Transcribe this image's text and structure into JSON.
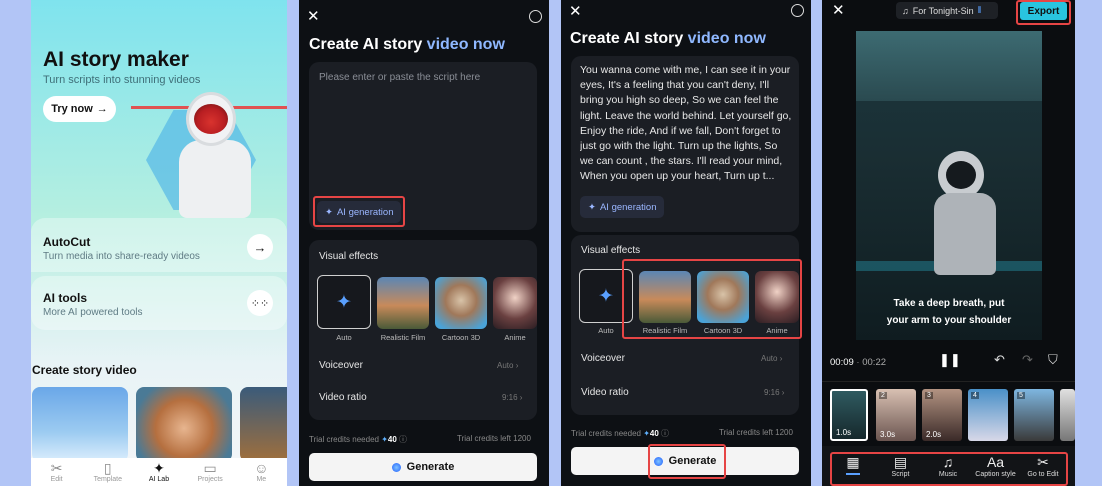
{
  "colors": {
    "accent_blue": "#5aa0ff",
    "highlight_red": "#e64545",
    "export_cyan": "#29c4df",
    "bg_dark": "#0d1014"
  },
  "screen1": {
    "hero_title": "AI story maker",
    "hero_subtitle": "Turn scripts into stunning videos",
    "try_button": "Try now",
    "try_icon": "arrow-right-icon",
    "autocut_title": "AutoCut",
    "autocut_subtitle": "Turn media into share-ready videos",
    "aitools_title": "AI tools",
    "aitools_subtitle": "More AI powered tools",
    "section_title": "Create story video",
    "tabs": [
      {
        "label": "Edit",
        "icon": "scissors-icon"
      },
      {
        "label": "Template",
        "icon": "template-icon"
      },
      {
        "label": "AI Lab",
        "icon": "sparkle-icon"
      },
      {
        "label": "Projects",
        "icon": "folder-icon"
      },
      {
        "label": "Me",
        "icon": "person-icon"
      }
    ]
  },
  "screen2": {
    "title_main": "Create AI story ",
    "title_accent": "video now",
    "placeholder": "Please enter or paste the script here",
    "ai_generation": "AI generation",
    "visual_effects": "Visual effects",
    "options": [
      "Auto",
      "Realistic Film",
      "Cartoon 3D",
      "Anime"
    ],
    "voiceover": "Voiceover",
    "voiceover_value": "Auto",
    "video_ratio": "Video ratio",
    "video_ratio_value": "9:16",
    "credits_needed": "Trial credits needed",
    "credits_amount": "40",
    "credits_left": "Trial credits left 1200",
    "generate": "Generate"
  },
  "screen3": {
    "title_main": "Create AI story ",
    "title_accent": "video now",
    "script": "You wanna come with me, I can see it in your eyes, It's a feeling that you can't deny, I'll bring you high so deep, So we can feel the light. Leave the world behind. Let yourself go, Enjoy the ride, And if we fall, Don't forget to just go with the light. Turn up the lights, So we can count , the stars. I'll read your mind, When you open up your heart, Turn up t...",
    "ai_generation": "AI generation",
    "visual_effects": "Visual effects",
    "options": [
      "Auto",
      "Realistic Film",
      "Cartoon 3D",
      "Anime"
    ],
    "voiceover": "Voiceover",
    "voiceover_value": "Auto",
    "video_ratio": "Video ratio",
    "video_ratio_value": "9:16",
    "credits_needed": "Trial credits needed",
    "credits_amount": "40",
    "credits_left": "Trial credits left 1200",
    "generate": "Generate"
  },
  "screen4": {
    "music_title": "For Tonight-Sin",
    "export": "Export",
    "caption_line1": "Take a deep breath, put",
    "caption_line2": "your arm to your shoulder",
    "time_current": "00:09",
    "time_total": "00:22",
    "clips": [
      {
        "num": "",
        "dur": "1.0s"
      },
      {
        "num": "2",
        "dur": "3.0s"
      },
      {
        "num": "3",
        "dur": "2.0s"
      },
      {
        "num": "4",
        "dur": ""
      },
      {
        "num": "5",
        "dur": ""
      }
    ],
    "tools": [
      {
        "label": "",
        "icon": "storyboard-icon"
      },
      {
        "label": "Script",
        "icon": "script-icon"
      },
      {
        "label": "Music",
        "icon": "music-icon"
      },
      {
        "label": "Caption style",
        "icon": "caption-icon"
      },
      {
        "label": "Go to Edit",
        "icon": "scissors-icon"
      }
    ]
  }
}
